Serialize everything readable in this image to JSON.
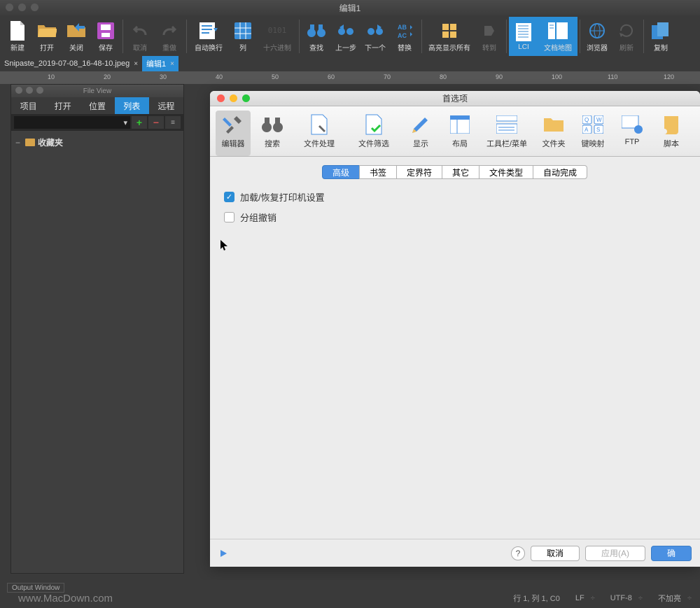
{
  "window": {
    "title": "编辑1"
  },
  "toolbar": {
    "new": "新建",
    "open": "打开",
    "close": "关闭",
    "save": "保存",
    "undo": "取消",
    "redo": "重做",
    "autowrap": "自动换行",
    "column": "列",
    "hex": "十六进制",
    "find": "查找",
    "prev": "上一步",
    "next": "下一个",
    "replace": "替换",
    "highlight": "高亮显示所有",
    "goto": "转到",
    "lci": "LCI",
    "docmap": "文档地图",
    "browser": "浏览器",
    "refresh": "刷新",
    "copy": "复制"
  },
  "tabs": [
    {
      "label": "Snipaste_2019-07-08_16-48-10.jpeg",
      "active": false
    },
    {
      "label": "编辑1",
      "active": true
    }
  ],
  "ruler": {
    "marks": [
      "10",
      "20",
      "30",
      "40",
      "50",
      "60",
      "70",
      "80",
      "90",
      "100",
      "110",
      "120"
    ]
  },
  "sidepanel": {
    "title": "File View",
    "tabs": {
      "project": "项目",
      "open": "打开",
      "location": "位置",
      "list": "列表",
      "remote": "远程"
    },
    "tree": {
      "favorites": "收藏夹"
    }
  },
  "prefs": {
    "title": "首选项",
    "toolbar": {
      "editor": "编辑器",
      "search": "搜索",
      "filehandle": "文件处理",
      "filefilter": "文件筛选",
      "display": "显示",
      "layout": "布局",
      "toolbarmenu": "工具栏/菜单",
      "folder": "文件夹",
      "keymap": "键映射",
      "ftp": "FTP",
      "script": "脚本"
    },
    "subtabs": {
      "advanced": "高级",
      "bookmark": "书签",
      "delimiter": "定界符",
      "other": "其它",
      "filetype": "文件类型",
      "autocomplete": "自动完成"
    },
    "checks": {
      "printer": "加载/恢复打印机设置",
      "groupundo": "分组撤销"
    },
    "footer": {
      "cancel": "取消",
      "apply": "应用(A)",
      "ok": "确"
    }
  },
  "status": {
    "outwin": "Output Window",
    "watermark": "www.MacDown.com",
    "pos": "行 1, 列 1, C0",
    "le": "LF",
    "enc": "UTF-8",
    "hl": "不加亮"
  }
}
